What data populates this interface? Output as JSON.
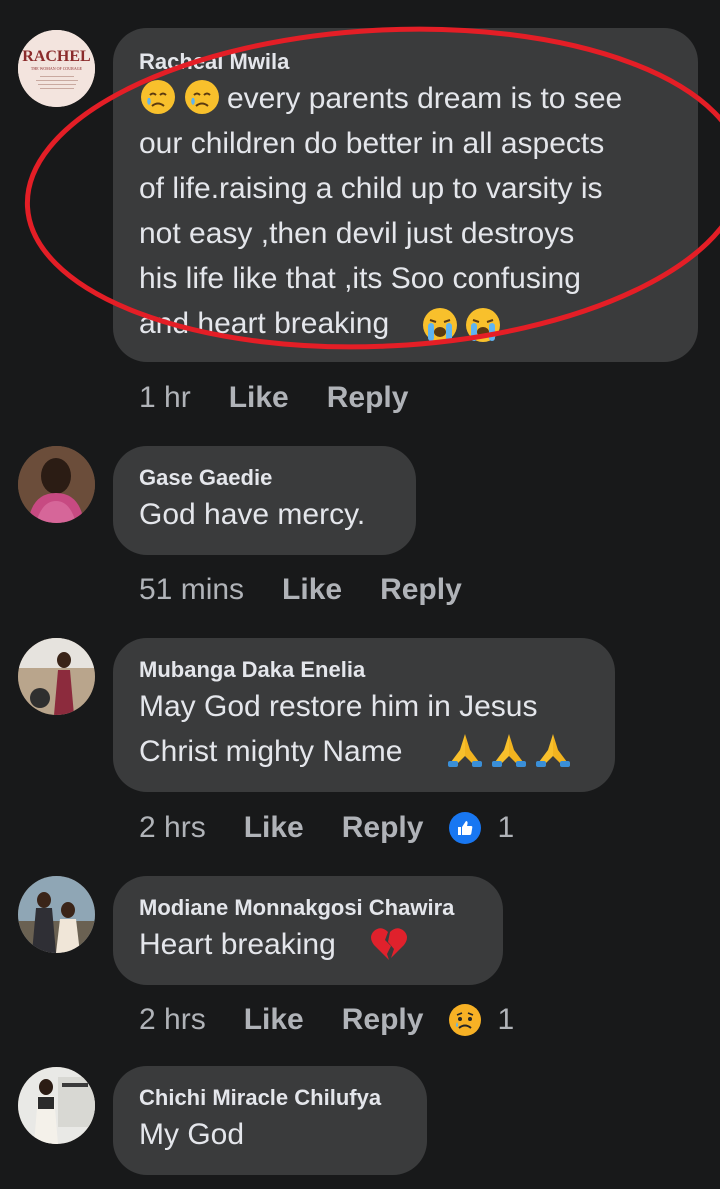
{
  "comments": [
    {
      "author": "Racheal Mwila",
      "text": "every parents dream is to see\nour children do better in all aspects\nof life.raising a child up to varsity is\nnot easy ,then devil just destroys\nhis life like that ,its Soo confusing\nand heart breaking",
      "avatar_text": "RACHEL",
      "avatar_subtext": "THE WOMAN OF COURAGE",
      "leading_emojis": [
        "sad-relieved-face",
        "sad-relieved-face"
      ],
      "trailing_emojis": [
        "loudly-crying-face",
        "loudly-crying-face"
      ],
      "time": "1 hr",
      "like": "Like",
      "reply": "Reply"
    },
    {
      "author": "Gase Gaedie",
      "text": "God have mercy.",
      "time": "51 mins",
      "like": "Like",
      "reply": "Reply"
    },
    {
      "author": "Mubanga Daka Enelia",
      "text": "May God restore him in Jesus\nChrist mighty Name",
      "trailing_emojis": [
        "folded-hands",
        "folded-hands",
        "folded-hands"
      ],
      "time": "2 hrs",
      "like": "Like",
      "reply": "Reply",
      "reaction": {
        "type": "like-icon",
        "count": "1",
        "color": "#1877f2"
      }
    },
    {
      "author": "Modiane Monnakgosi Chawira",
      "text": "Heart breaking",
      "trailing_emojis": [
        "broken-heart"
      ],
      "time": "2 hrs",
      "like": "Like",
      "reply": "Reply",
      "reaction": {
        "type": "sad-icon",
        "count": "1",
        "color": "#f7b125"
      }
    },
    {
      "author": "Chichi Miracle Chilufya",
      "text": "My God"
    }
  ],
  "colors": {
    "background": "#18191a",
    "bubble": "#3a3b3c",
    "text": "#e4e6eb",
    "muted": "#b0b3b8",
    "annotation": "#e41e26"
  }
}
